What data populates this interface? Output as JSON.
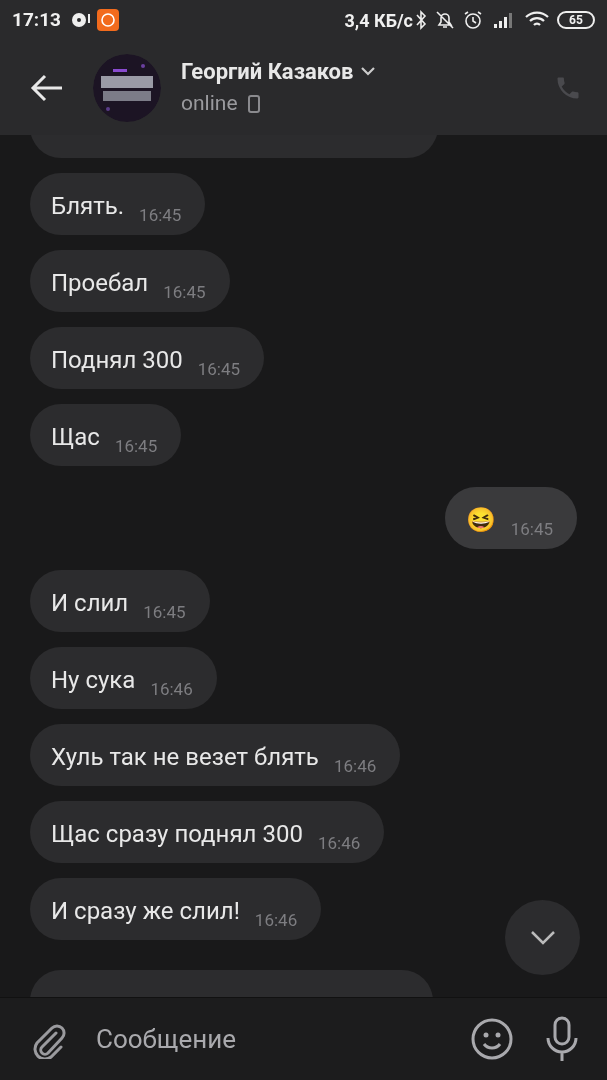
{
  "status_bar": {
    "time": "17:13",
    "network_speed": "3,4 КБ/с",
    "battery": "65"
  },
  "header": {
    "name": "Георгий Казаков",
    "presence": "online"
  },
  "messages": [
    {
      "text": "Блять.",
      "time": "16:45",
      "outgoing": false
    },
    {
      "text": "Проебал",
      "time": "16:45",
      "outgoing": false
    },
    {
      "text": "Поднял 300",
      "time": "16:45",
      "outgoing": false
    },
    {
      "text": "Щас",
      "time": "16:45",
      "outgoing": false
    },
    {
      "text": "😆",
      "time": "16:45",
      "outgoing": true
    },
    {
      "text": "И слил",
      "time": "16:45",
      "outgoing": false
    },
    {
      "text": "Ну сука",
      "time": "16:46",
      "outgoing": false
    },
    {
      "text": "Хуль так не везет блять",
      "time": "16:46",
      "outgoing": false
    },
    {
      "text": "Щас сразу поднял 300",
      "time": "16:46",
      "outgoing": false
    },
    {
      "text": "И сразу же слил!",
      "time": "16:46",
      "outgoing": false
    }
  ],
  "composer": {
    "placeholder": "Сообщение"
  }
}
